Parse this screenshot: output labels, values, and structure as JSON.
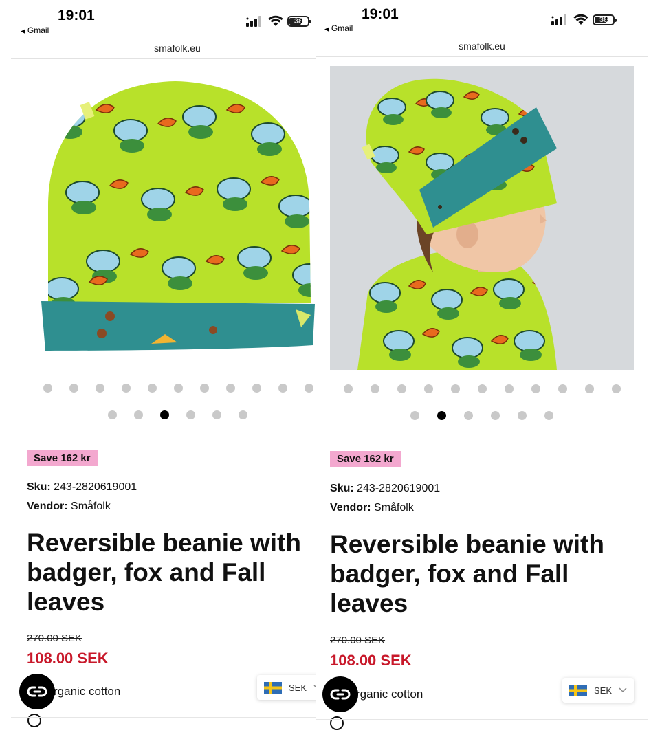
{
  "screens": [
    {
      "status": {
        "time": "19:01",
        "back_app": "Gmail",
        "battery": "38"
      },
      "url": "smafolk.eu",
      "carousel": {
        "top_dots": 11,
        "bottom_dots": 6,
        "active_index": 2
      },
      "product": {
        "save_label": "Save 162 kr",
        "sku_label": "Sku:",
        "sku": "243-2820619001",
        "vendor_label": "Vendor:",
        "vendor": "Småfolk",
        "title_lines": [
          "Reversible beanie with",
          "badger, fox and Fall",
          "leaves"
        ],
        "old_price": "270.00 SEK",
        "new_price": "108.00 SEK",
        "feature": "rganic cotton"
      },
      "currency": {
        "code": "SEK"
      }
    },
    {
      "status": {
        "time": "19:01",
        "back_app": "Gmail",
        "battery": "38"
      },
      "url": "smafolk.eu",
      "carousel": {
        "top_dots": 11,
        "bottom_dots": 6,
        "active_index": 1
      },
      "product": {
        "save_label": "Save 162 kr",
        "sku_label": "Sku:",
        "sku": "243-2820619001",
        "vendor_label": "Vendor:",
        "vendor": "Småfolk",
        "title_lines": [
          "Reversible beanie with",
          "badger, fox and Fall",
          "leaves"
        ],
        "old_price": "270.00 SEK",
        "new_price": "108.00 SEK",
        "feature": "rganic cotton"
      },
      "currency": {
        "code": "SEK"
      }
    }
  ],
  "icons": {
    "signal": "cellular-signal-icon",
    "wifi": "wifi-icon",
    "battery": "battery-icon",
    "chat": "chat-link-icon",
    "flag": "sweden-flag-icon",
    "chevron": "chevron-down-icon"
  },
  "colors": {
    "save_badge": "#f3a8cf",
    "sale_price": "#c8182a",
    "beanie_green": "#b8e12a",
    "beanie_teal": "#2f8f90",
    "dot_active": "#000000",
    "dot_inactive": "#c9c9c9"
  }
}
